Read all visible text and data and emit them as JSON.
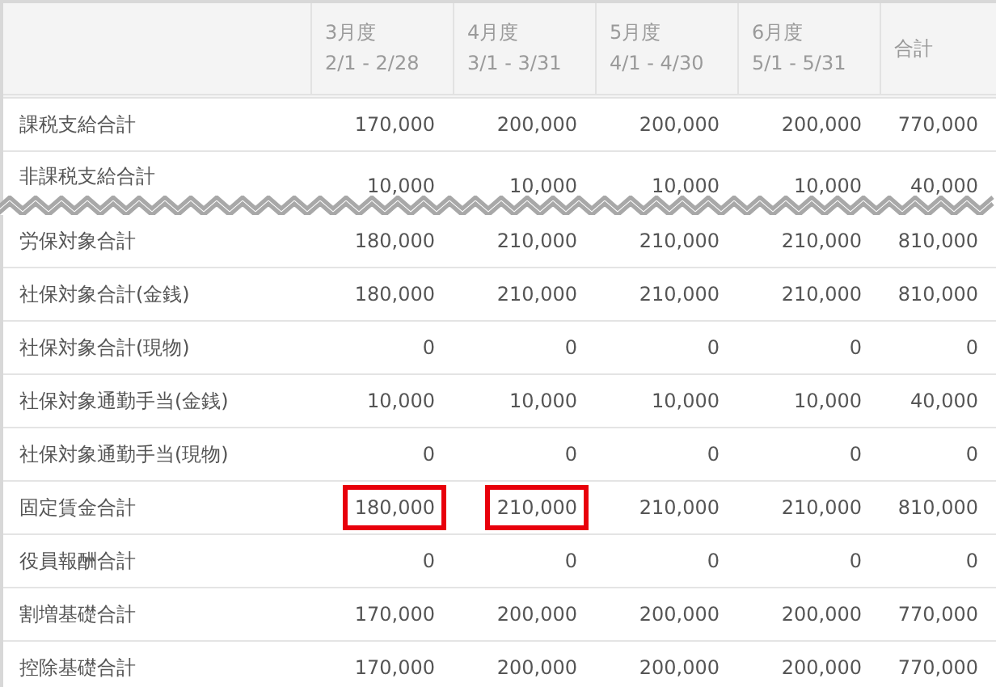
{
  "table": {
    "columns": [
      {
        "title": "3月度",
        "subtitle": "2/1 - 2/28"
      },
      {
        "title": "4月度",
        "subtitle": "3/1 - 3/31"
      },
      {
        "title": "5月度",
        "subtitle": "4/1 - 4/30"
      },
      {
        "title": "6月度",
        "subtitle": "5/1 - 5/31"
      },
      {
        "title": "合計"
      }
    ],
    "rows_before_break": [
      {
        "label": "課税支給合計",
        "cells": [
          {
            "text": "170,000",
            "highlighted": false
          },
          {
            "text": "200,000",
            "highlighted": false
          },
          {
            "text": "200,000",
            "highlighted": false
          },
          {
            "text": "200,000",
            "highlighted": false
          },
          {
            "text": "770,000",
            "highlighted": false
          }
        ]
      },
      {
        "label": "非課税支給合計",
        "cells": [
          {
            "text": "10,000",
            "highlighted": false
          },
          {
            "text": "10,000",
            "highlighted": false
          },
          {
            "text": "10,000",
            "highlighted": false
          },
          {
            "text": "10,000",
            "highlighted": false
          },
          {
            "text": "40,000",
            "highlighted": false
          }
        ]
      }
    ],
    "rows_after_break": [
      {
        "label": "労保対象合計",
        "cells": [
          {
            "text": "180,000",
            "highlighted": false
          },
          {
            "text": "210,000",
            "highlighted": false
          },
          {
            "text": "210,000",
            "highlighted": false
          },
          {
            "text": "210,000",
            "highlighted": false
          },
          {
            "text": "810,000",
            "highlighted": false
          }
        ]
      },
      {
        "label": "社保対象合計(金銭)",
        "cells": [
          {
            "text": "180,000",
            "highlighted": false
          },
          {
            "text": "210,000",
            "highlighted": false
          },
          {
            "text": "210,000",
            "highlighted": false
          },
          {
            "text": "210,000",
            "highlighted": false
          },
          {
            "text": "810,000",
            "highlighted": false
          }
        ]
      },
      {
        "label": "社保対象合計(現物)",
        "cells": [
          {
            "text": "0",
            "highlighted": false
          },
          {
            "text": "0",
            "highlighted": false
          },
          {
            "text": "0",
            "highlighted": false
          },
          {
            "text": "0",
            "highlighted": false
          },
          {
            "text": "0",
            "highlighted": false
          }
        ]
      },
      {
        "label": "社保対象通勤手当(金銭)",
        "cells": [
          {
            "text": "10,000",
            "highlighted": false
          },
          {
            "text": "10,000",
            "highlighted": false
          },
          {
            "text": "10,000",
            "highlighted": false
          },
          {
            "text": "10,000",
            "highlighted": false
          },
          {
            "text": "40,000",
            "highlighted": false
          }
        ]
      },
      {
        "label": "社保対象通勤手当(現物)",
        "cells": [
          {
            "text": "0",
            "highlighted": false
          },
          {
            "text": "0",
            "highlighted": false
          },
          {
            "text": "0",
            "highlighted": false
          },
          {
            "text": "0",
            "highlighted": false
          },
          {
            "text": "0",
            "highlighted": false
          }
        ]
      },
      {
        "label": "固定賃金合計",
        "cells": [
          {
            "text": "180,000",
            "highlighted": true
          },
          {
            "text": "210,000",
            "highlighted": true
          },
          {
            "text": "210,000",
            "highlighted": false
          },
          {
            "text": "210,000",
            "highlighted": false
          },
          {
            "text": "810,000",
            "highlighted": false
          }
        ]
      },
      {
        "label": "役員報酬合計",
        "cells": [
          {
            "text": "0",
            "highlighted": false
          },
          {
            "text": "0",
            "highlighted": false
          },
          {
            "text": "0",
            "highlighted": false
          },
          {
            "text": "0",
            "highlighted": false
          },
          {
            "text": "0",
            "highlighted": false
          }
        ]
      },
      {
        "label": "割増基礎合計",
        "cells": [
          {
            "text": "170,000",
            "highlighted": false
          },
          {
            "text": "200,000",
            "highlighted": false
          },
          {
            "text": "200,000",
            "highlighted": false
          },
          {
            "text": "200,000",
            "highlighted": false
          },
          {
            "text": "770,000",
            "highlighted": false
          }
        ]
      },
      {
        "label": "控除基礎合計",
        "cells": [
          {
            "text": "170,000",
            "highlighted": false
          },
          {
            "text": "200,000",
            "highlighted": false
          },
          {
            "text": "200,000",
            "highlighted": false
          },
          {
            "text": "200,000",
            "highlighted": false
          },
          {
            "text": "770,000",
            "highlighted": false
          }
        ]
      }
    ]
  }
}
